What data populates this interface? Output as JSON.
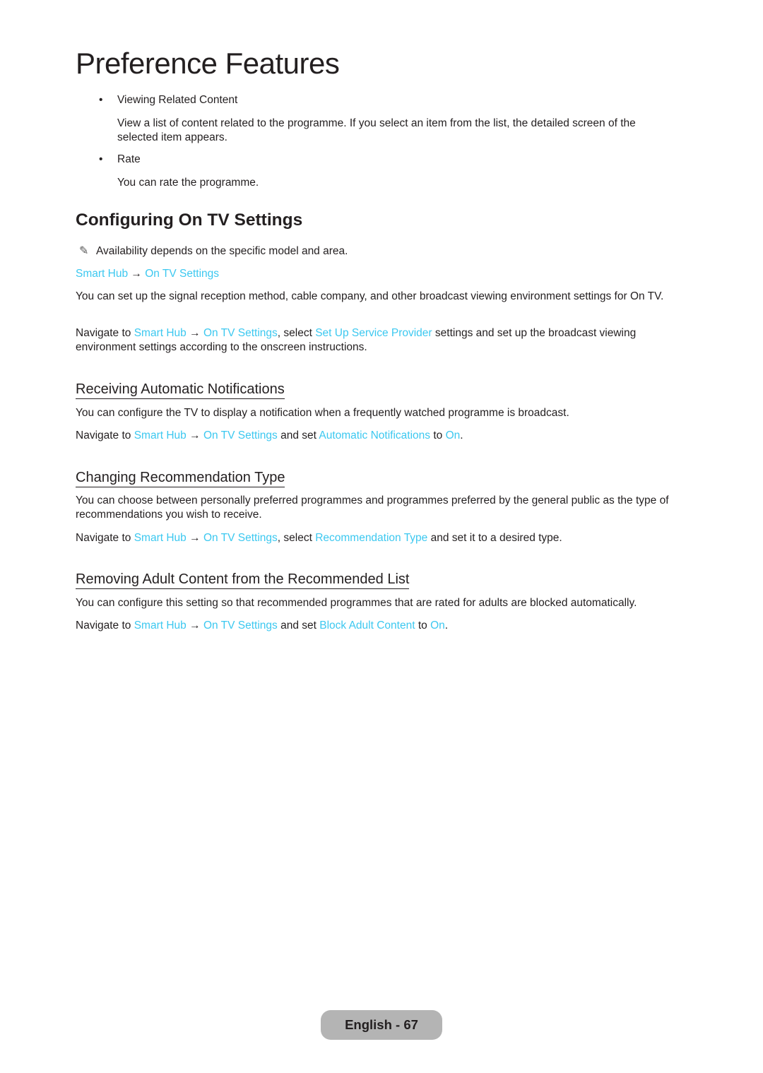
{
  "page_title": "Preference Features",
  "bullets": [
    {
      "title": "Viewing Related Content",
      "text": "View a list of content related to the programme. If you select an item from the list, the detailed screen of the selected item appears."
    },
    {
      "title": "Rate",
      "text": "You can rate the programme."
    }
  ],
  "section": {
    "title": "Configuring On TV Settings",
    "note_icon": "pencil-note-icon",
    "note": "Availability depends on the specific model and area.",
    "path": {
      "a": "Smart Hub",
      "arrow": "→",
      "b": "On TV Settings"
    },
    "description": "You can set up the signal reception method, cable company, and other broadcast viewing environment settings for On TV.",
    "navigate": {
      "prefix": "Navigate to ",
      "a": "Smart Hub",
      "arrow": " → ",
      "b": "On TV Settings",
      "mid": ", select ",
      "c": "Set Up Service Provider",
      "suffix": " settings and set up the broadcast viewing environment settings according to the onscreen instructions."
    }
  },
  "subsections": [
    {
      "title": "Receiving Automatic Notifications",
      "description": "You can configure the TV to display a notification when a frequently watched programme is broadcast.",
      "nav": {
        "prefix": "Navigate to ",
        "a": "Smart Hub",
        "arrow": " → ",
        "b": "On TV Settings",
        "mid": " and set ",
        "c": "Automatic Notifications",
        "mid2": " to ",
        "d": "On",
        "suffix": "."
      }
    },
    {
      "title": "Changing Recommendation Type",
      "description": "You can choose between personally preferred programmes and programmes preferred by the general public as the type of recommendations you wish to receive.",
      "nav": {
        "prefix": "Navigate to ",
        "a": "Smart Hub",
        "arrow": " → ",
        "b": "On TV Settings",
        "mid": ", select ",
        "c": "Recommendation Type",
        "suffix": " and set it to a desired type."
      }
    },
    {
      "title": "Removing Adult Content from the Recommended List",
      "description": "You can configure this setting so that recommended programmes that are rated for adults are blocked automatically.",
      "nav": {
        "prefix": "Navigate to ",
        "a": "Smart Hub",
        "arrow": " → ",
        "b": "On TV Settings",
        "mid": " and set ",
        "c": "Block Adult Content",
        "mid2": " to ",
        "d": "On",
        "suffix": "."
      }
    }
  ],
  "footer": {
    "label": "English - 67"
  },
  "colors": {
    "link": "#3cc8f0",
    "text": "#231f20",
    "footer_bg": "#b4b4b4"
  }
}
